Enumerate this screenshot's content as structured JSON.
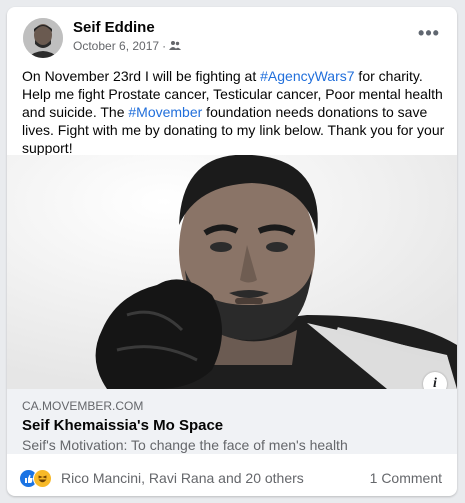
{
  "post": {
    "author": "Seif Eddine",
    "date": "October 6, 2017",
    "separator": "·",
    "audience_icon": "friends-icon",
    "more_icon": "more-options-icon",
    "text_parts": {
      "p1": "On November 23rd I will be fighting at ",
      "tag1": "#AgencyWars7",
      "p2": " for charity. Help me fight Prostate cancer, Testicular cancer, Poor mental health and suicide. The ",
      "tag2": "#Movember",
      "p3": " foundation needs donations to save lives. Fight with me by donating to my link below. Thank you for your support!"
    },
    "hashtag_color": "#216fdb"
  },
  "link": {
    "domain": "CA.MOVEMBER.COM",
    "title": "Seif Khemaissia's Mo Space",
    "description": "Seif's Motivation: To change the face of men's health",
    "info_glyph": "i"
  },
  "footer": {
    "reactions": [
      "like",
      "haha"
    ],
    "names": "Rico Mancini, Ravi Rana and 20 others",
    "comments": "1 Comment"
  },
  "colors": {
    "like": "#1b74e4",
    "haha": "#f7b928",
    "meta": "#65676b"
  }
}
